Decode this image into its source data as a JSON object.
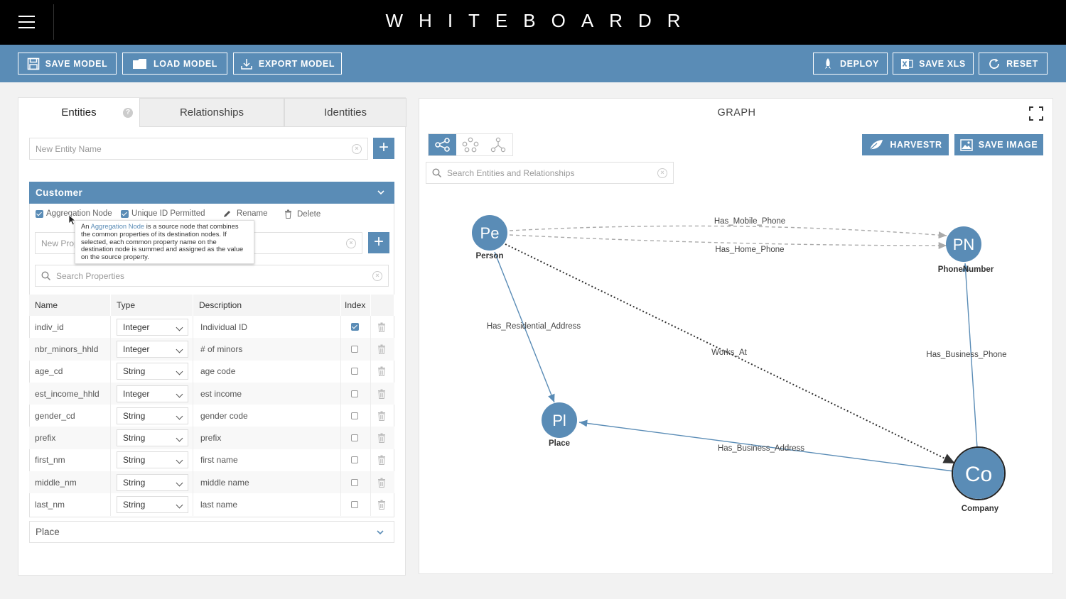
{
  "header": {
    "brand": "WHITEBOARDR"
  },
  "toolbar": {
    "save_model": "SAVE MODEL",
    "load_model": "LOAD MODEL",
    "export_model": "EXPORT MODEL",
    "deploy": "DEPLOY",
    "save_xls": "SAVE XLS",
    "reset": "RESET"
  },
  "left": {
    "tabs": [
      "Entities",
      "Relationships",
      "Identities"
    ],
    "help": "?",
    "new_entity_placeholder": "New Entity Name",
    "entity": {
      "name": "Customer",
      "options": {
        "aggregation": "Aggregation Node",
        "unique_id": "Unique ID Permitted",
        "rename": "Rename",
        "delete": "Delete"
      },
      "new_property_placeholder": "New Property Name",
      "search_placeholder": "Search Properties",
      "tooltip": {
        "pre": "An ",
        "term": "Aggregation Node",
        "post": " is a source node that combines the common properties of its destination nodes. If selected, each common property name on the destination node is summed and assigned as the value on the source property."
      },
      "columns": [
        "Name",
        "Type",
        "Description",
        "Index"
      ],
      "rows": [
        {
          "name": "indiv_id",
          "type": "Integer",
          "desc": "Individual ID",
          "index": true
        },
        {
          "name": "nbr_minors_hhld",
          "type": "Integer",
          "desc": "# of minors",
          "index": false
        },
        {
          "name": "age_cd",
          "type": "String",
          "desc": "age code",
          "index": false
        },
        {
          "name": "est_income_hhld",
          "type": "Integer",
          "desc": "est income",
          "index": false
        },
        {
          "name": "gender_cd",
          "type": "String",
          "desc": "gender code",
          "index": false
        },
        {
          "name": "prefix",
          "type": "String",
          "desc": "prefix",
          "index": false
        },
        {
          "name": "first_nm",
          "type": "String",
          "desc": "first name",
          "index": false
        },
        {
          "name": "middle_nm",
          "type": "String",
          "desc": "middle name",
          "index": false
        },
        {
          "name": "last_nm",
          "type": "String",
          "desc": "last name",
          "index": false
        }
      ]
    },
    "collapsed_entity": "Place"
  },
  "graph": {
    "title": "GRAPH",
    "harvestr": "HARVESTR",
    "save_image": "SAVE IMAGE",
    "search_placeholder": "Search Entities and Relationships",
    "colors": {
      "node": "#5a8cb6",
      "edge": "#5a8cb6",
      "dashed": "#aaaaaa",
      "dotted": "#333333"
    },
    "nodes": [
      {
        "id": "person",
        "abbr": "Pe",
        "label": "Person"
      },
      {
        "id": "phone",
        "abbr": "PN",
        "label": "PhoneNumber"
      },
      {
        "id": "place",
        "abbr": "Pl",
        "label": "Place"
      },
      {
        "id": "company",
        "abbr": "Co",
        "label": "Company"
      }
    ],
    "edges": [
      {
        "label": "Has_Mobile_Phone"
      },
      {
        "label": "Has_Home_Phone"
      },
      {
        "label": "Has_Residential_Address"
      },
      {
        "label": "Works_At"
      },
      {
        "label": "Has_Business_Phone"
      },
      {
        "label": "Has_Business_Address"
      }
    ]
  }
}
